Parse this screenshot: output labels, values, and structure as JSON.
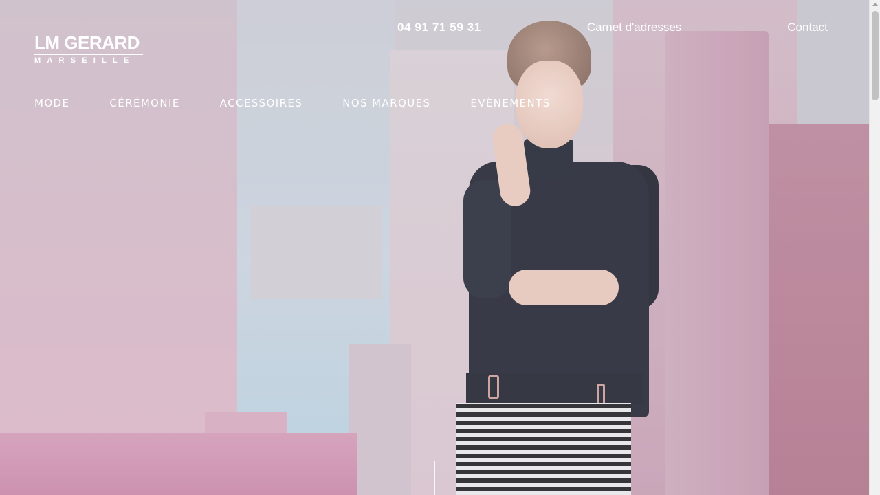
{
  "brand": {
    "name": "LM GERARD",
    "city": "MARSEILLE"
  },
  "topbar": {
    "phone": "04 91 71 59 31",
    "links": [
      "Carnet d'adresses",
      "Contact"
    ]
  },
  "nav": {
    "items": [
      "MODE",
      "CÉRÉMONIE",
      "ACCESSOIRES",
      "NOS MARQUES",
      "EVÈNEMENTS"
    ]
  },
  "hero": {
    "image": "model-in-black-top-and-patterned-skirt-pink-architecture"
  },
  "colors": {
    "text": "#ffffff",
    "scrollbar_track": "#f1f1f1",
    "scrollbar_thumb": "#c1c1c1"
  }
}
